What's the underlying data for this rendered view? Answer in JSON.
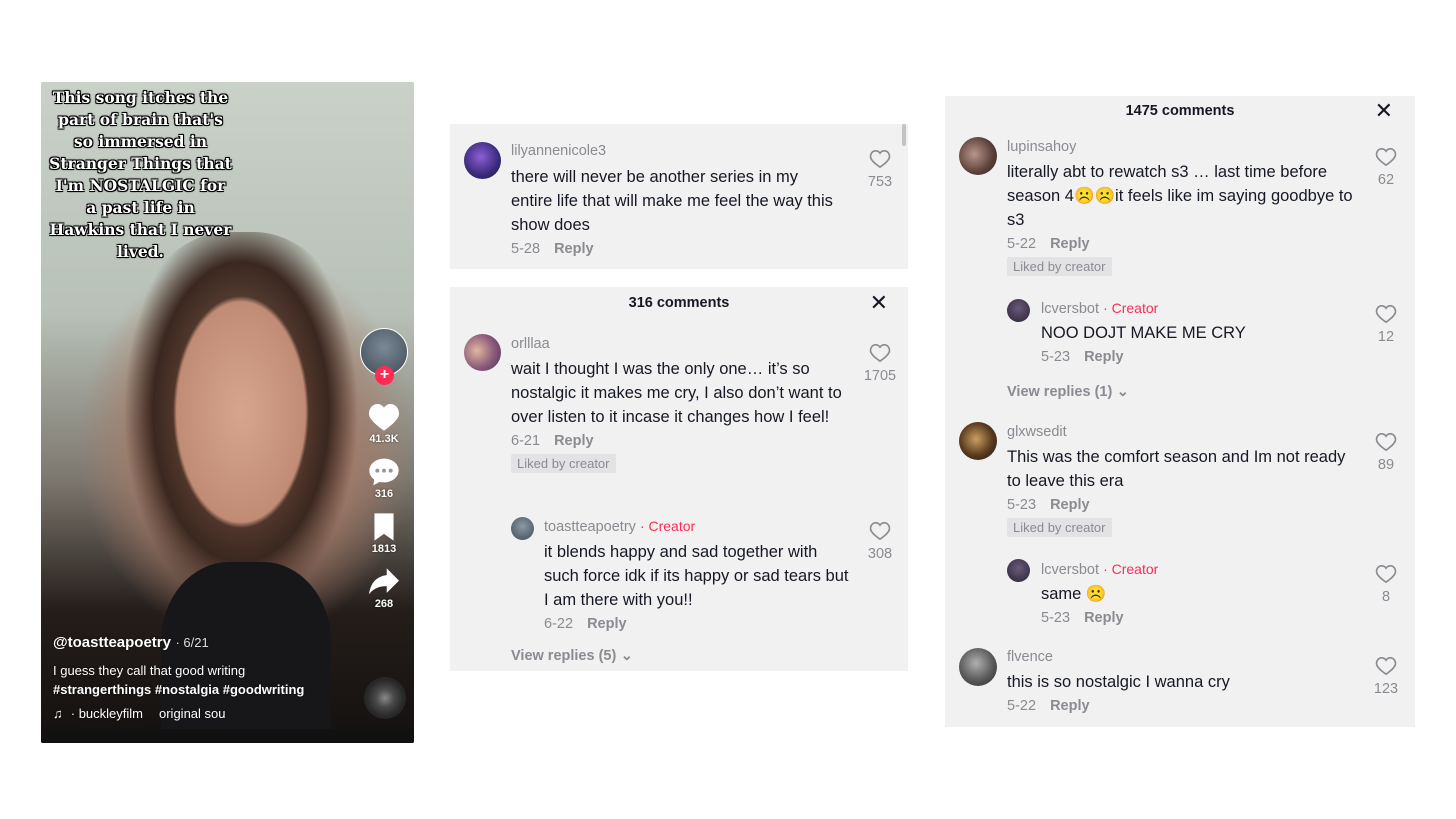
{
  "video": {
    "caption": "This song itches the part of brain that's so immersed in Stranger Things that I'm NOSTALGIC for a past life in Hawkins that I never lived.",
    "likes": "41.3K",
    "comments": "316",
    "saves": "1813",
    "shares": "268",
    "username": "@toastteapoetry",
    "date": "· 6/21",
    "description": "I guess they call that good writing",
    "hashtags": "#strangerthings #nostalgia #goodwriting",
    "music_artist": "· buckleyfilm",
    "music_track": "original sou"
  },
  "panel_middle_top": {
    "comment": {
      "user": "lilyannenicole3",
      "text": "there will never be another series in my entire life that will make me feel the way this show does",
      "date": "5-28",
      "reply_label": "Reply",
      "likes": "753"
    }
  },
  "panel_middle_bottom": {
    "title": "316 comments",
    "comment": {
      "user": "orlllaa",
      "text": "wait I thought I was the only one… it’s so nostalgic it makes me cry, I also don’t want to over listen to it incase it changes how I feel!",
      "date": "6-21",
      "reply_label": "Reply",
      "liked_by_creator": "Liked by creator",
      "likes": "1705"
    },
    "reply": {
      "user": "toastteapoetry",
      "creator_tag": "· Creator",
      "text": "it blends happy and sad together with such force idk if its happy or sad tears but I am there with you!!",
      "date": "6-22",
      "reply_label": "Reply",
      "likes": "308"
    },
    "view_replies": "View replies (5)"
  },
  "panel_right": {
    "title": "1475 comments",
    "comments": [
      {
        "user": "lupinsahoy",
        "text": "literally abt to rewatch s3 … last time before season 4☹️☹️it feels like im saying goodbye to s3",
        "date": "5-22",
        "reply_label": "Reply",
        "liked_by_creator": "Liked by creator",
        "likes": "62"
      },
      {
        "user": "glxwsedit",
        "text": "This was the comfort season and Im not ready to leave this era",
        "date": "5-23",
        "reply_label": "Reply",
        "liked_by_creator": "Liked by creator",
        "likes": "89"
      },
      {
        "user": "flvence",
        "text": "this is so nostalgic I wanna cry",
        "date": "5-22",
        "reply_label": "Reply",
        "likes": "123"
      }
    ],
    "replies": [
      {
        "user": "lcversbot",
        "creator_tag": "· Creator",
        "text": "NOO DOJT MAKE ME CRY",
        "date": "5-23",
        "reply_label": "Reply",
        "likes": "12"
      },
      {
        "user": "lcversbot",
        "creator_tag": "· Creator",
        "text": "same ☹️",
        "date": "5-23",
        "reply_label": "Reply",
        "likes": "8"
      }
    ],
    "view_replies": "View replies (1)"
  },
  "colors": {
    "accent": "#fe2c55",
    "panel_bg": "#f1f1f2",
    "muted_text": "#8a8b91"
  }
}
